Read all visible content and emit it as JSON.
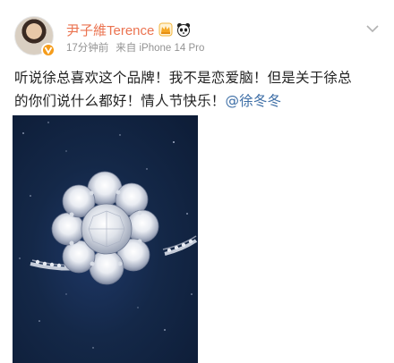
{
  "post": {
    "author": {
      "username": "尹子維Terence",
      "avatar_icon": "avatar-photo",
      "verified_icon": "verified-badge-icon",
      "badges": [
        "crown-icon",
        "panda-icon"
      ]
    },
    "meta": {
      "time": "17分钟前",
      "source": "来自 iPhone 14 Pro"
    },
    "more_icon": "chevron-down-icon",
    "text": {
      "line1": "听说徐总喜欢这个品牌！我不是恋爱脑！但是关于徐总",
      "line2": "的你们说什么都好！情人节快乐！",
      "mention": "@徐冬冬"
    },
    "image": {
      "subject": "diamond-ring-photo"
    }
  },
  "colors": {
    "username": "#eb7350",
    "meta": "#939393",
    "mention": "#3d6ea6",
    "text": "#222222",
    "photo_bg": "#142848"
  }
}
